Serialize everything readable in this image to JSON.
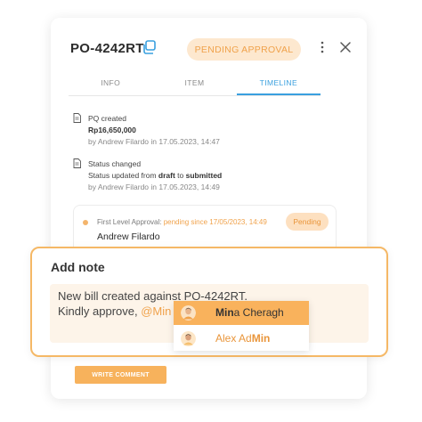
{
  "header": {
    "po_number": "PO-4242RT",
    "status": "PENDING APPROVAL",
    "icons": [
      "copy-icon",
      "more-vertical-icon",
      "close-icon"
    ]
  },
  "tabs": [
    {
      "label": "INFO",
      "active": false
    },
    {
      "label": "ITEM",
      "active": false
    },
    {
      "label": "TIMELINE",
      "active": true
    }
  ],
  "timeline": [
    {
      "icon": "document-icon",
      "title": "PQ created",
      "amount": "Rp16,650,000",
      "meta": "by Andrew Filardo in 17.05.2023, 14:47"
    },
    {
      "icon": "document-icon",
      "title": "Status changed",
      "desc_prefix": "Status updated from ",
      "from": "draft",
      "desc_mid": " to ",
      "to": "submitted",
      "meta": "by Andrew Filardo in 17.05.2023, 14:49"
    }
  ],
  "approval": {
    "label": "First Level Approval: ",
    "pending_text": "pending since 17/05/2023, 14:49",
    "name": "Andrew Filardo",
    "badge": "Pending"
  },
  "note": {
    "title": "Add note",
    "line1": "New bill created against PO-4242RT.",
    "line2": "Kindly approve, ",
    "mention": "@Min"
  },
  "mention_options": [
    {
      "pre": "",
      "match": "Min",
      "post": "a Cheragh",
      "highlighted": true
    },
    {
      "pre": "Alex Ad",
      "match": "Min",
      "post": "",
      "highlighted": false
    }
  ],
  "write_button": "WRITE COMMENT",
  "colors": {
    "accent": "#f7b25c",
    "tab_active": "#3aa0df",
    "pill_bg": "#fde8cf"
  }
}
